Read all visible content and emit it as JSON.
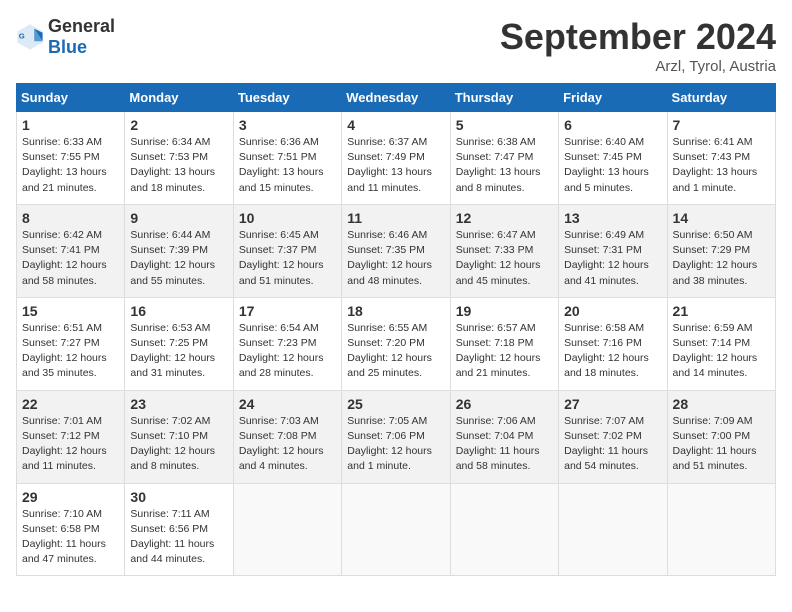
{
  "header": {
    "logo_general": "General",
    "logo_blue": "Blue",
    "month_title": "September 2024",
    "location": "Arzl, Tyrol, Austria"
  },
  "calendar": {
    "weekdays": [
      "Sunday",
      "Monday",
      "Tuesday",
      "Wednesday",
      "Thursday",
      "Friday",
      "Saturday"
    ],
    "weeks": [
      [
        {
          "day": "1",
          "sunrise": "6:33 AM",
          "sunset": "7:55 PM",
          "daylight": "13 hours and 21 minutes."
        },
        {
          "day": "2",
          "sunrise": "6:34 AM",
          "sunset": "7:53 PM",
          "daylight": "13 hours and 18 minutes."
        },
        {
          "day": "3",
          "sunrise": "6:36 AM",
          "sunset": "7:51 PM",
          "daylight": "13 hours and 15 minutes."
        },
        {
          "day": "4",
          "sunrise": "6:37 AM",
          "sunset": "7:49 PM",
          "daylight": "13 hours and 11 minutes."
        },
        {
          "day": "5",
          "sunrise": "6:38 AM",
          "sunset": "7:47 PM",
          "daylight": "13 hours and 8 minutes."
        },
        {
          "day": "6",
          "sunrise": "6:40 AM",
          "sunset": "7:45 PM",
          "daylight": "13 hours and 5 minutes."
        },
        {
          "day": "7",
          "sunrise": "6:41 AM",
          "sunset": "7:43 PM",
          "daylight": "13 hours and 1 minute."
        }
      ],
      [
        {
          "day": "8",
          "sunrise": "6:42 AM",
          "sunset": "7:41 PM",
          "daylight": "12 hours and 58 minutes."
        },
        {
          "day": "9",
          "sunrise": "6:44 AM",
          "sunset": "7:39 PM",
          "daylight": "12 hours and 55 minutes."
        },
        {
          "day": "10",
          "sunrise": "6:45 AM",
          "sunset": "7:37 PM",
          "daylight": "12 hours and 51 minutes."
        },
        {
          "day": "11",
          "sunrise": "6:46 AM",
          "sunset": "7:35 PM",
          "daylight": "12 hours and 48 minutes."
        },
        {
          "day": "12",
          "sunrise": "6:47 AM",
          "sunset": "7:33 PM",
          "daylight": "12 hours and 45 minutes."
        },
        {
          "day": "13",
          "sunrise": "6:49 AM",
          "sunset": "7:31 PM",
          "daylight": "12 hours and 41 minutes."
        },
        {
          "day": "14",
          "sunrise": "6:50 AM",
          "sunset": "7:29 PM",
          "daylight": "12 hours and 38 minutes."
        }
      ],
      [
        {
          "day": "15",
          "sunrise": "6:51 AM",
          "sunset": "7:27 PM",
          "daylight": "12 hours and 35 minutes."
        },
        {
          "day": "16",
          "sunrise": "6:53 AM",
          "sunset": "7:25 PM",
          "daylight": "12 hours and 31 minutes."
        },
        {
          "day": "17",
          "sunrise": "6:54 AM",
          "sunset": "7:23 PM",
          "daylight": "12 hours and 28 minutes."
        },
        {
          "day": "18",
          "sunrise": "6:55 AM",
          "sunset": "7:20 PM",
          "daylight": "12 hours and 25 minutes."
        },
        {
          "day": "19",
          "sunrise": "6:57 AM",
          "sunset": "7:18 PM",
          "daylight": "12 hours and 21 minutes."
        },
        {
          "day": "20",
          "sunrise": "6:58 AM",
          "sunset": "7:16 PM",
          "daylight": "12 hours and 18 minutes."
        },
        {
          "day": "21",
          "sunrise": "6:59 AM",
          "sunset": "7:14 PM",
          "daylight": "12 hours and 14 minutes."
        }
      ],
      [
        {
          "day": "22",
          "sunrise": "7:01 AM",
          "sunset": "7:12 PM",
          "daylight": "12 hours and 11 minutes."
        },
        {
          "day": "23",
          "sunrise": "7:02 AM",
          "sunset": "7:10 PM",
          "daylight": "12 hours and 8 minutes."
        },
        {
          "day": "24",
          "sunrise": "7:03 AM",
          "sunset": "7:08 PM",
          "daylight": "12 hours and 4 minutes."
        },
        {
          "day": "25",
          "sunrise": "7:05 AM",
          "sunset": "7:06 PM",
          "daylight": "12 hours and 1 minute."
        },
        {
          "day": "26",
          "sunrise": "7:06 AM",
          "sunset": "7:04 PM",
          "daylight": "11 hours and 58 minutes."
        },
        {
          "day": "27",
          "sunrise": "7:07 AM",
          "sunset": "7:02 PM",
          "daylight": "11 hours and 54 minutes."
        },
        {
          "day": "28",
          "sunrise": "7:09 AM",
          "sunset": "7:00 PM",
          "daylight": "11 hours and 51 minutes."
        }
      ],
      [
        {
          "day": "29",
          "sunrise": "7:10 AM",
          "sunset": "6:58 PM",
          "daylight": "11 hours and 47 minutes."
        },
        {
          "day": "30",
          "sunrise": "7:11 AM",
          "sunset": "6:56 PM",
          "daylight": "11 hours and 44 minutes."
        },
        null,
        null,
        null,
        null,
        null
      ]
    ]
  }
}
